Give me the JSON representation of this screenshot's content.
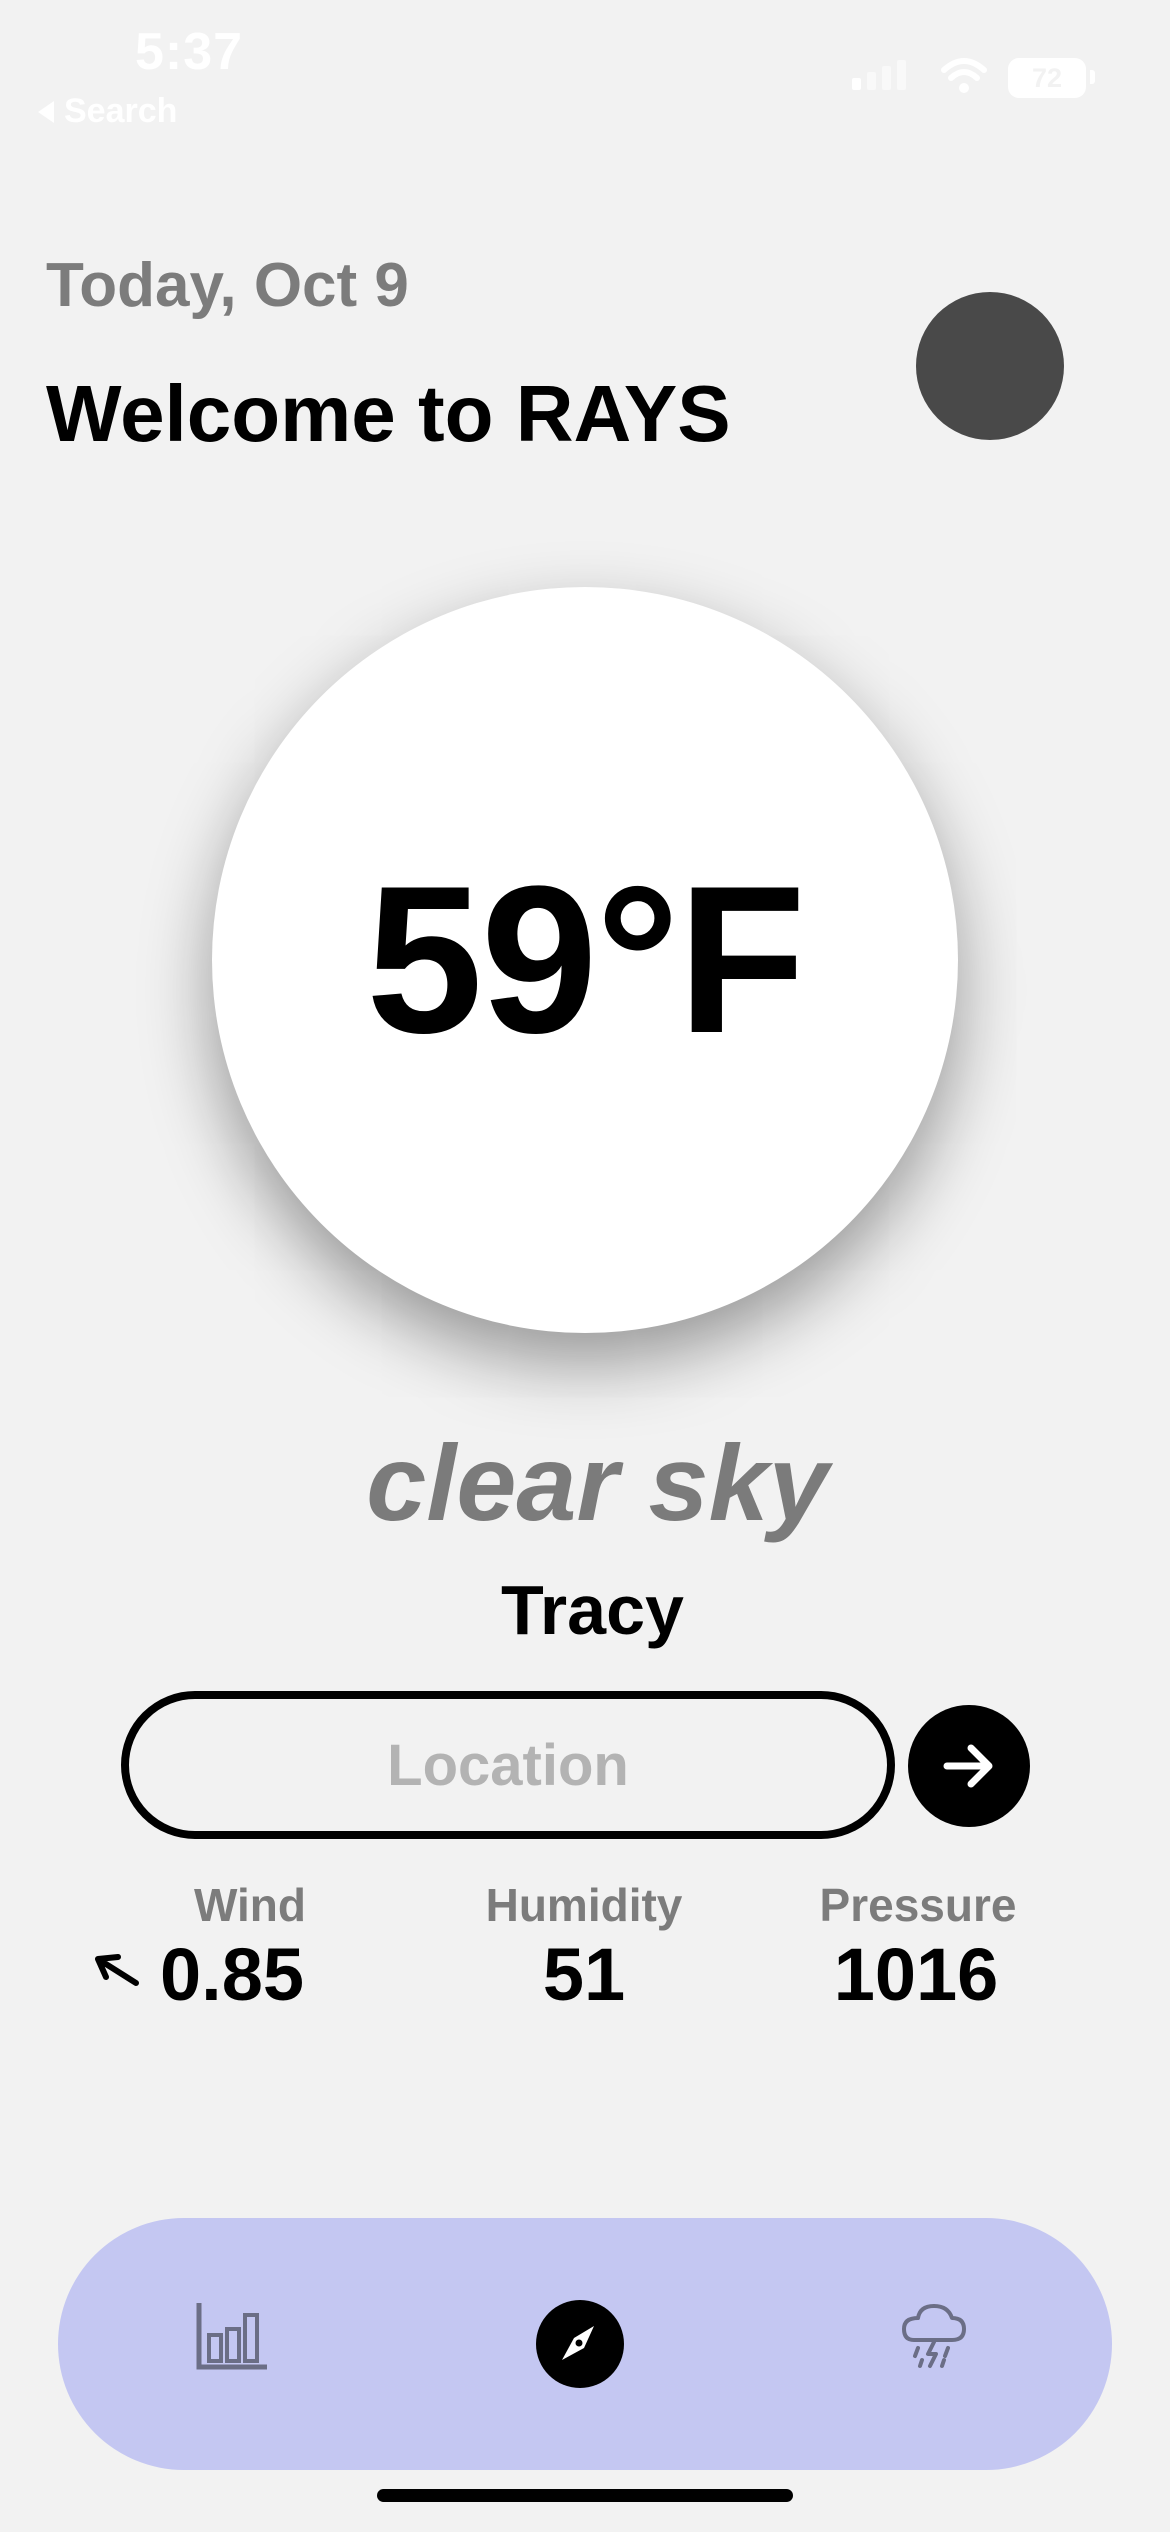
{
  "status_bar": {
    "time": "5:37",
    "back_label": "Search",
    "battery": "72"
  },
  "header": {
    "date": "Today, Oct 9",
    "title": "Welcome to RAYS"
  },
  "weather": {
    "temperature": "59°F",
    "condition": "clear sky",
    "city": "Tracy"
  },
  "search": {
    "placeholder": "Location",
    "value": ""
  },
  "stats": {
    "wind_label": "Wind",
    "wind_value": "0.85",
    "humidity_label": "Humidity",
    "humidity_value": "51",
    "pressure_label": "Pressure",
    "pressure_value": "1016"
  },
  "nav": {
    "items": [
      {
        "icon": "bar-chart-icon",
        "active": false
      },
      {
        "icon": "compass-icon",
        "active": true
      },
      {
        "icon": "thunderstorm-icon",
        "active": false
      }
    ],
    "bar_color": "#c4c7f2"
  }
}
